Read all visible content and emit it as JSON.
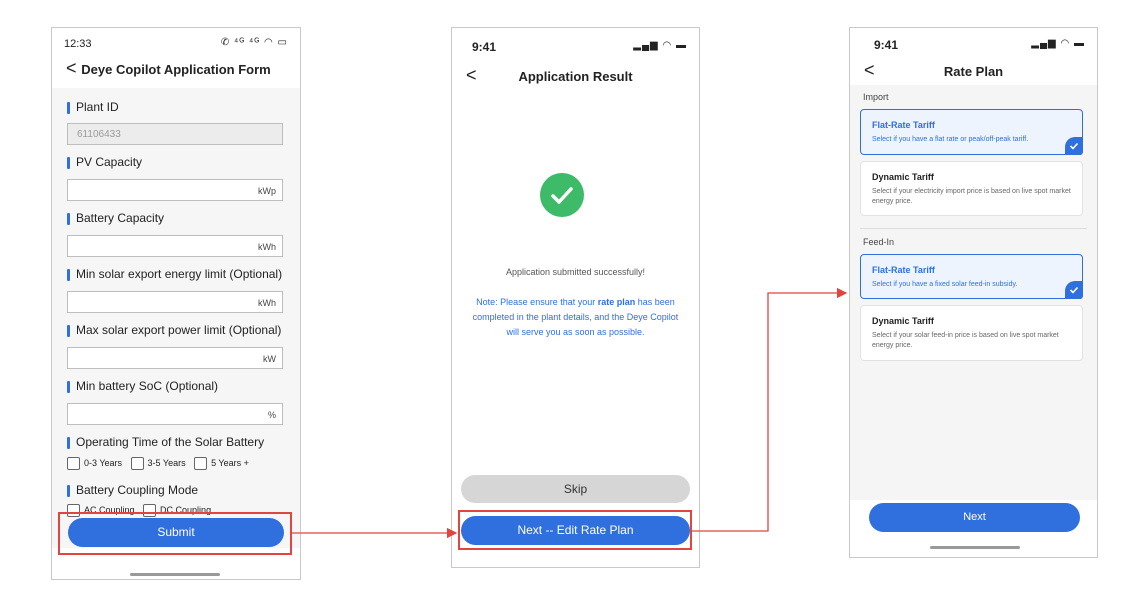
{
  "form": {
    "status_time": "12:33",
    "status_icons": "✆ ⁴ᴳ ⁴ᴳ ◠ ▭",
    "back": "<",
    "title": "Deye Copilot Application Form",
    "plant_id_label": "Plant ID",
    "plant_id_value": "61106433",
    "pv_label": "PV Capacity",
    "pv_unit": "kWp",
    "battery_label": "Battery Capacity",
    "battery_unit": "kWh",
    "min_export_label": "Min solar export energy limit (Optional)",
    "min_export_unit": "kWh",
    "max_export_label": "Max solar export power limit (Optional)",
    "max_export_unit": "kW",
    "min_soc_label": "Min battery SoC (Optional)",
    "min_soc_unit": "%",
    "operating_label": "Operating Time of the Solar Battery",
    "operating_options": [
      "0-3 Years",
      "3-5 Years",
      "5 Years +"
    ],
    "coupling_label": "Battery Coupling Mode",
    "coupling_options": [
      "AC Coupling",
      "DC Coupling"
    ],
    "submit": "Submit"
  },
  "result": {
    "status_time": "9:41",
    "status_icons": "▂▄▆ ◠ ▬",
    "back": "<",
    "title": "Application Result",
    "success_text": "Application submitted successfully!",
    "note_prefix": "Note: Please ensure that your",
    "note_bold": "rate plan",
    "note_suffix": "has been completed in the plant details, and the Deye Copilot will serve you as soon as possible.",
    "skip": "Skip",
    "next": "Next -- Edit Rate Plan"
  },
  "rate_plan": {
    "status_time": "9:41",
    "status_icons": "▂▄▆ ◠ ▬",
    "back": "<",
    "title": "Rate Plan",
    "import_label": "Import",
    "import_flat_title": "Flat-Rate Tariff",
    "import_flat_desc": "Select if you have a flat rate or peak/off-peak tariff.",
    "import_dynamic_title": "Dynamic Tariff",
    "import_dynamic_desc": "Select if your electricity import price is based on live spot market energy price.",
    "feedin_label": "Feed-In",
    "feedin_flat_title": "Flat-Rate Tariff",
    "feedin_flat_desc": "Select if you have a fixed solar feed-in subsidy.",
    "feedin_dynamic_title": "Dynamic Tariff",
    "feedin_dynamic_desc": "Select if your solar feed-in price is based on live spot market energy price.",
    "next": "Next"
  },
  "colors": {
    "accent": "#2f6fde",
    "highlight": "#e0463f",
    "success": "#3dbb68"
  }
}
